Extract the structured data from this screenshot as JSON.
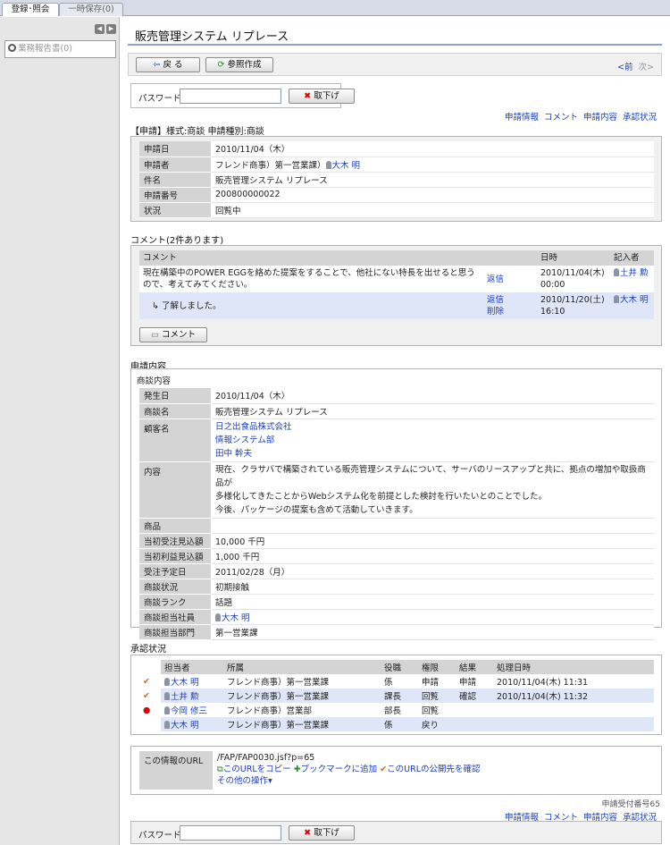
{
  "tabs": [
    "登録･照会",
    "一時保存(0)"
  ],
  "sidebar": {
    "search_label": "業務報告書(0)"
  },
  "page": {
    "title": "販売管理システム リプレース"
  },
  "toolbar": {
    "back": "戻 る",
    "copy_create": "参照作成",
    "prev": "<前",
    "next": "次>"
  },
  "password": {
    "label": "パスワード",
    "value": "",
    "withdraw": "取下げ"
  },
  "navlinks": [
    "申請情報",
    "コメント",
    "申請内容",
    "承認状況"
  ],
  "request": {
    "heading": "【申請】様式:商談 申請種別:商談",
    "rows": [
      {
        "k": "申請日",
        "v": "2010/11/04（木）"
      },
      {
        "k": "申請者",
        "v": "フレンド商事）第一営業課）",
        "user": "大木 明"
      },
      {
        "k": "件名",
        "v": "販売管理システム リプレース"
      },
      {
        "k": "申請番号",
        "v": "200800000022"
      },
      {
        "k": "状況",
        "v": "回覧中"
      }
    ]
  },
  "comments": {
    "heading": "コメント(2件あります)",
    "cols": [
      "コメント",
      "日時",
      "記入者"
    ],
    "items": [
      {
        "text": "現在構築中のPOWER EGGを絡めた提案をすることで、他社にない特長を出せると思うので、考えてみてください。",
        "actions": [
          "返信"
        ],
        "date": "2010/11/04(木)",
        "time": "00:00",
        "user": "土井 勲"
      },
      {
        "text": "↳ 了解しました。",
        "actions": [
          "返信",
          "削除"
        ],
        "date": "2010/11/20(土)",
        "time": "16:10",
        "user": "大木 明"
      }
    ],
    "comment_button": "コメント"
  },
  "content": {
    "heading": "申請内容",
    "subheading": "商談内容",
    "rows": [
      {
        "k": "発生日",
        "v": [
          "2010/11/04（木）"
        ]
      },
      {
        "k": "商談名",
        "v": [
          "販売管理システム リプレース"
        ]
      },
      {
        "k": "顧客名",
        "v": [
          "日之出食品株式会社",
          "情報システム部",
          "田中 幹夫"
        ],
        "link": true
      },
      {
        "k": "内容",
        "v": [
          "現在、クラサバで構築されている販売管理システムについて、サーバのリースアップと共に、拠点の増加や取扱商品が",
          "多様化してきたことからWebシステム化を前提とした検討を行いたいとのことでした。",
          "今後、パッケージの提案も含めて活動していきます。"
        ]
      },
      {
        "k": "商品",
        "v": [
          ""
        ]
      },
      {
        "k": "当初受注見込額",
        "v": [
          "10,000 千円"
        ]
      },
      {
        "k": "当初利益見込額",
        "v": [
          "1,000 千円"
        ]
      },
      {
        "k": "受注予定日",
        "v": [
          "2011/02/28（月）"
        ]
      },
      {
        "k": "商談状況",
        "v": [
          "初期接触"
        ]
      },
      {
        "k": "商談ランク",
        "v": [
          "話題"
        ]
      },
      {
        "k": "商談担当社員",
        "v": [
          "大木 明"
        ],
        "userlink": true
      },
      {
        "k": "商談担当部門",
        "v": [
          "第一営業課"
        ]
      }
    ]
  },
  "approval": {
    "heading": "承認状況",
    "cols": [
      "担当者",
      "所属",
      "役職",
      "権限",
      "結果",
      "処理日時"
    ],
    "rows": [
      {
        "mark": "✔",
        "user": "大木 明",
        "dept": "フレンド商事）第一営業課",
        "pos": "係",
        "role": "申請",
        "result": "申請",
        "date": "2010/11/04(木) 11:31"
      },
      {
        "mark": "✔",
        "user": "土井 勲",
        "dept": "フレンド商事）第一営業課",
        "pos": "課長",
        "role": "回覧",
        "result": "確認",
        "date": "2010/11/04(木) 11:32"
      },
      {
        "mark": "●",
        "user": "今岡 修三",
        "dept": "フレンド商事）営業部",
        "pos": "部長",
        "role": "回覧",
        "result": "",
        "date": ""
      },
      {
        "mark": "",
        "user": "大木 明",
        "dept": "フレンド商事）第一営業課",
        "pos": "係",
        "role": "戻り",
        "result": "",
        "date": ""
      }
    ]
  },
  "urlinfo": {
    "label": "この情報のURL",
    "url": "/FAP/FAP0030.jsf?p=65",
    "copy": "このURLをコピー",
    "bookmark": "ブックマークに追加",
    "check": "このURLの公開先を確認",
    "other": "その他の操作"
  },
  "receipt": "申請受付番号65"
}
